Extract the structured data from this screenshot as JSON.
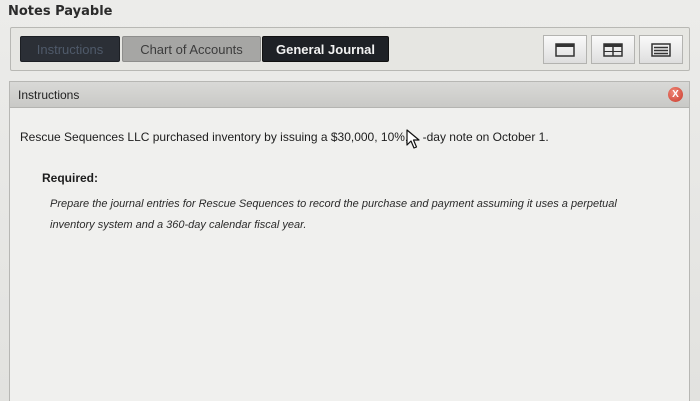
{
  "app": {
    "title": "Notes Payable"
  },
  "tabs": [
    {
      "label": "Instructions"
    },
    {
      "label": "Chart of Accounts"
    },
    {
      "label": "General Journal"
    }
  ],
  "view_buttons": [
    "single-panel-icon",
    "split-panel-icon",
    "list-view-icon"
  ],
  "panel": {
    "title": "Instructions",
    "close_label": "X",
    "problem_before": "Rescue Sequences LLC purchased inventory by issuing a $30,000, 10%, ",
    "problem_after": "-day note on October 1.",
    "required_label": "Required:",
    "required_text": "Prepare the journal entries for Rescue Sequences to record the purchase and payment assuming it uses a perpetual inventory system and a 360-day calendar fiscal year."
  },
  "colors": {
    "close_button": "#c9382a",
    "active_tab": "#1e2126"
  }
}
